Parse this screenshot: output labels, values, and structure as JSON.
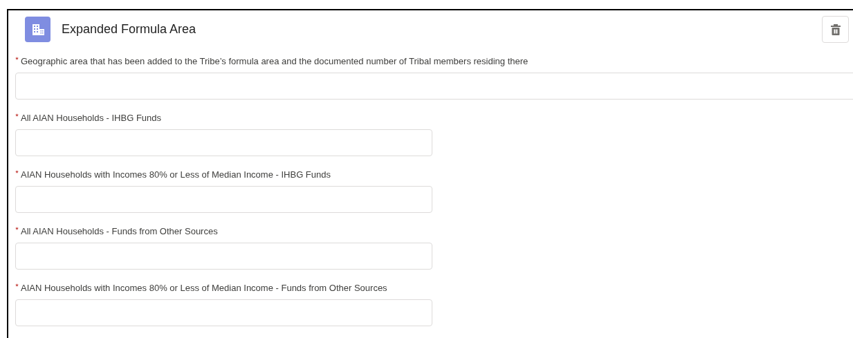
{
  "card": {
    "title": "Expanded Formula Area"
  },
  "fields": [
    {
      "label": "Geographic area that has been added to the Tribe’s formula area and the documented number of Tribal members residing there",
      "required": true,
      "kind": "wide"
    },
    {
      "label": "All AIAN Households - IHBG Funds",
      "required": true,
      "kind": "narrow"
    },
    {
      "label": "AIAN Households with Incomes 80% or Less of Median Income - IHBG Funds",
      "required": true,
      "kind": "narrow"
    },
    {
      "label": "All AIAN Households - Funds from Other Sources",
      "required": true,
      "kind": "narrow"
    },
    {
      "label": "AIAN Households with Incomes 80% or Less of Median Income - Funds from Other Sources",
      "required": true,
      "kind": "narrow"
    }
  ]
}
